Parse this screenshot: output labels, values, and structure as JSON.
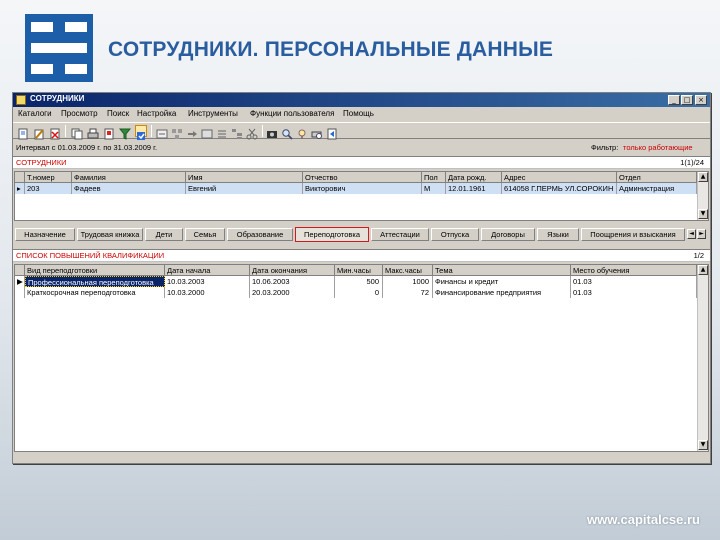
{
  "slide": {
    "title": "СОТРУДНИКИ. ПЕРСОНАЛЬНЫЕ ДАННЫЕ",
    "footer_url": "www.capitalcse.ru"
  },
  "window": {
    "title": "СОТРУДНИКИ",
    "buttons": {
      "minimize": "_",
      "maximize": "□",
      "close": "×"
    }
  },
  "menu": [
    "Каталоги",
    "Просмотр",
    "Поиск",
    "Настройка",
    "Инструменты",
    "Функции пользователя",
    "Помощь"
  ],
  "toolbar_icons": [
    "new-icon",
    "edit-icon",
    "delete-icon",
    "copy-icon",
    "print-icon",
    "report-icon",
    "filter-icon",
    "refresh-icon",
    "select-icon",
    "group-icon",
    "link-icon",
    "card-icon",
    "list-icon",
    "tree-icon",
    "cut-icon",
    "camera-icon",
    "search-icon",
    "find-icon",
    "print-preview-icon",
    "export-icon"
  ],
  "filter": {
    "interval": "Интервал с 01.03.2009 г. по 31.03.2009 г.",
    "label": "Фильтр:",
    "value": "только работающие"
  },
  "employees": {
    "title": "СОТРУДНИКИ",
    "counter": "1(1)/24",
    "columns": [
      "Т.номер",
      "Фамилия",
      "Имя",
      "Отчество",
      "Пол",
      "Дата рожд.",
      "Адрес",
      "Отдел"
    ],
    "rows": [
      [
        "203",
        "Фадеев",
        "Евгений",
        "Викторович",
        "М",
        "12.01.1961",
        "614058 Г.ПЕРМЬ УЛ.СОРОКИН",
        "Администрация"
      ]
    ]
  },
  "tabs": {
    "items": [
      "Назначение",
      "Трудовая книжка",
      "Дети",
      "Семья",
      "Образование",
      "Переподготовка",
      "Аттестации",
      "Отпуска",
      "Договоры",
      "Языки",
      "Поощрения и взыскания"
    ],
    "active_index": 5
  },
  "qualification": {
    "title": "СПИСОК ПОВЫШЕНИЙ КВАЛИФИКАЦИИ",
    "counter": "1/2",
    "columns": [
      "Вид переподготовки",
      "Дата начала",
      "Дата окончания",
      "Мин.часы",
      "Макс.часы",
      "Тема",
      "Место обучения"
    ],
    "rows": [
      [
        "Профессиональная переподготовка",
        "10.03.2003",
        "10.06.2003",
        "500",
        "1000",
        "Финансы и кредит",
        "01.03"
      ],
      [
        "Краткосрочная переподготовка",
        "10.03.2000",
        "20.03.2000",
        "0",
        "72",
        "Финансирование предприятия",
        "01.03"
      ]
    ]
  },
  "colors": {
    "slide_title": "#2a5d9f",
    "logo": "#1d5ea9",
    "titlebar_start": "#0a246a",
    "section_title": "#cc0000",
    "window_face": "#d4d0c8"
  }
}
